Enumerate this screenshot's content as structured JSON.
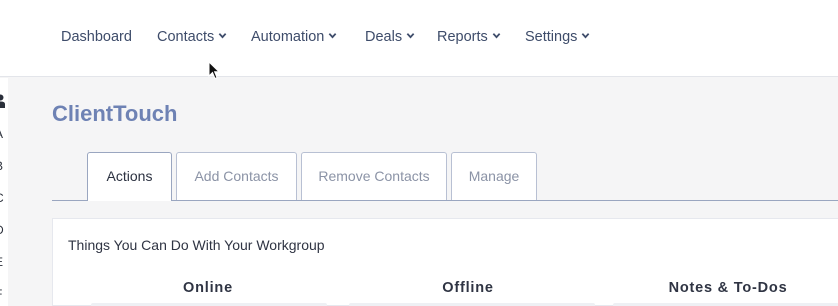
{
  "nav": {
    "items": [
      {
        "label": "Dashboard",
        "has_dropdown": false
      },
      {
        "label": "Contacts",
        "has_dropdown": true
      },
      {
        "label": "Automation",
        "has_dropdown": true
      },
      {
        "label": "Deals",
        "has_dropdown": true
      },
      {
        "label": "Reports",
        "has_dropdown": true
      },
      {
        "label": "Settings",
        "has_dropdown": true
      }
    ]
  },
  "sidebar": {
    "icon": "person-icon",
    "letters": [
      "A",
      "B",
      "C",
      "D",
      "E",
      "F"
    ]
  },
  "page": {
    "title": "ClientTouch"
  },
  "tabs": [
    {
      "label": "Actions",
      "active": true
    },
    {
      "label": "Add Contacts",
      "active": false
    },
    {
      "label": "Remove Contacts",
      "active": false
    },
    {
      "label": "Manage",
      "active": false
    }
  ],
  "panel": {
    "title": "Things You Can Do With Your Workgroup",
    "columns": [
      "Online",
      "Offline",
      "Notes & To-Dos"
    ]
  },
  "colors": {
    "title": "#6e82b4",
    "nav_text": "#3e4c6a",
    "tab_border": "#b8c0d3"
  }
}
